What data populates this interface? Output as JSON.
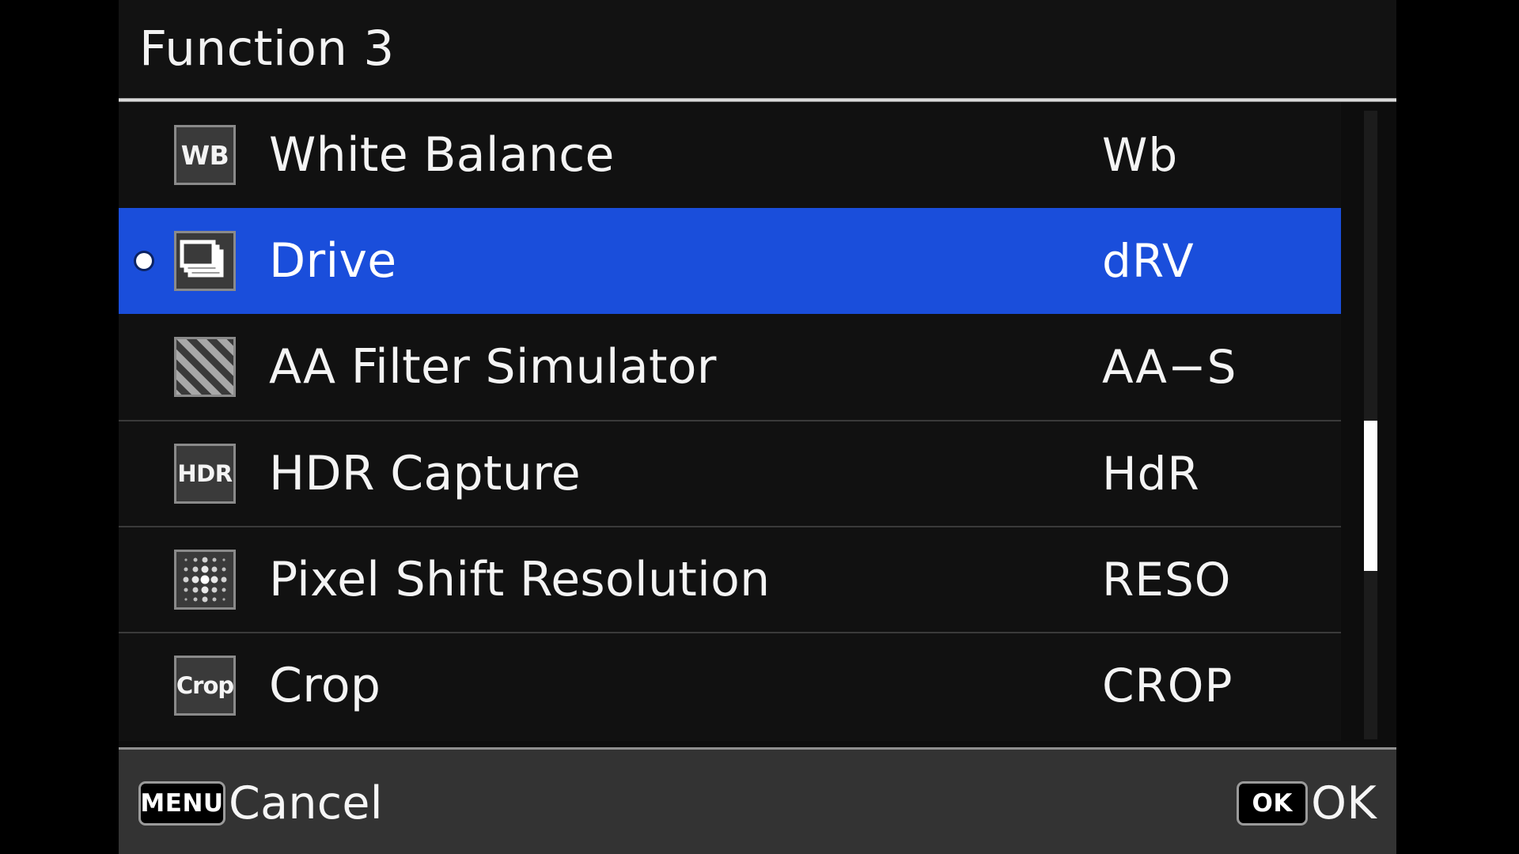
{
  "header": {
    "title": "Function 3"
  },
  "colors": {
    "highlight_blue": "#1a4edb",
    "panel_background": "#111111",
    "bottom_bar": "#333333",
    "text": "#f4f4f4",
    "icon_fill": "#3a3a3a",
    "icon_border": "#8a8a8a",
    "scrollbar_thumb": "#ffffff"
  },
  "menu": {
    "rows": [
      {
        "label": "White Balance",
        "abbr": "Wb",
        "icon": "white-balance-icon",
        "icon_text": "WB",
        "icon_kind": "text",
        "selected": false,
        "marked": false
      },
      {
        "label": "Drive",
        "abbr": "dRV",
        "icon": "drive-stacked-frames-icon",
        "icon_text": "",
        "icon_kind": "frames",
        "selected": true,
        "marked": true
      },
      {
        "label": "AA Filter Simulator",
        "abbr": "AA−S",
        "icon": "aa-filter-diagonal-stripes-icon",
        "icon_text": "",
        "icon_kind": "stripes",
        "selected": false,
        "marked": false
      },
      {
        "label": "HDR Capture",
        "abbr": "HdR",
        "icon": "hdr-capture-icon",
        "icon_text": "HDR",
        "icon_kind": "text",
        "selected": false,
        "marked": false
      },
      {
        "label": "Pixel Shift Resolution",
        "abbr": "RESO",
        "icon": "pixel-shift-dot-grid-icon",
        "icon_text": "",
        "icon_kind": "dots",
        "selected": false,
        "marked": false
      },
      {
        "label": "Crop",
        "abbr": "CROP",
        "icon": "crop-icon",
        "icon_text": "Crop",
        "icon_kind": "text",
        "selected": false,
        "marked": false
      }
    ]
  },
  "bottom_bar": {
    "cancel_key": "MENU",
    "cancel_label": "Cancel",
    "ok_key": "OK",
    "ok_label": "OK"
  }
}
